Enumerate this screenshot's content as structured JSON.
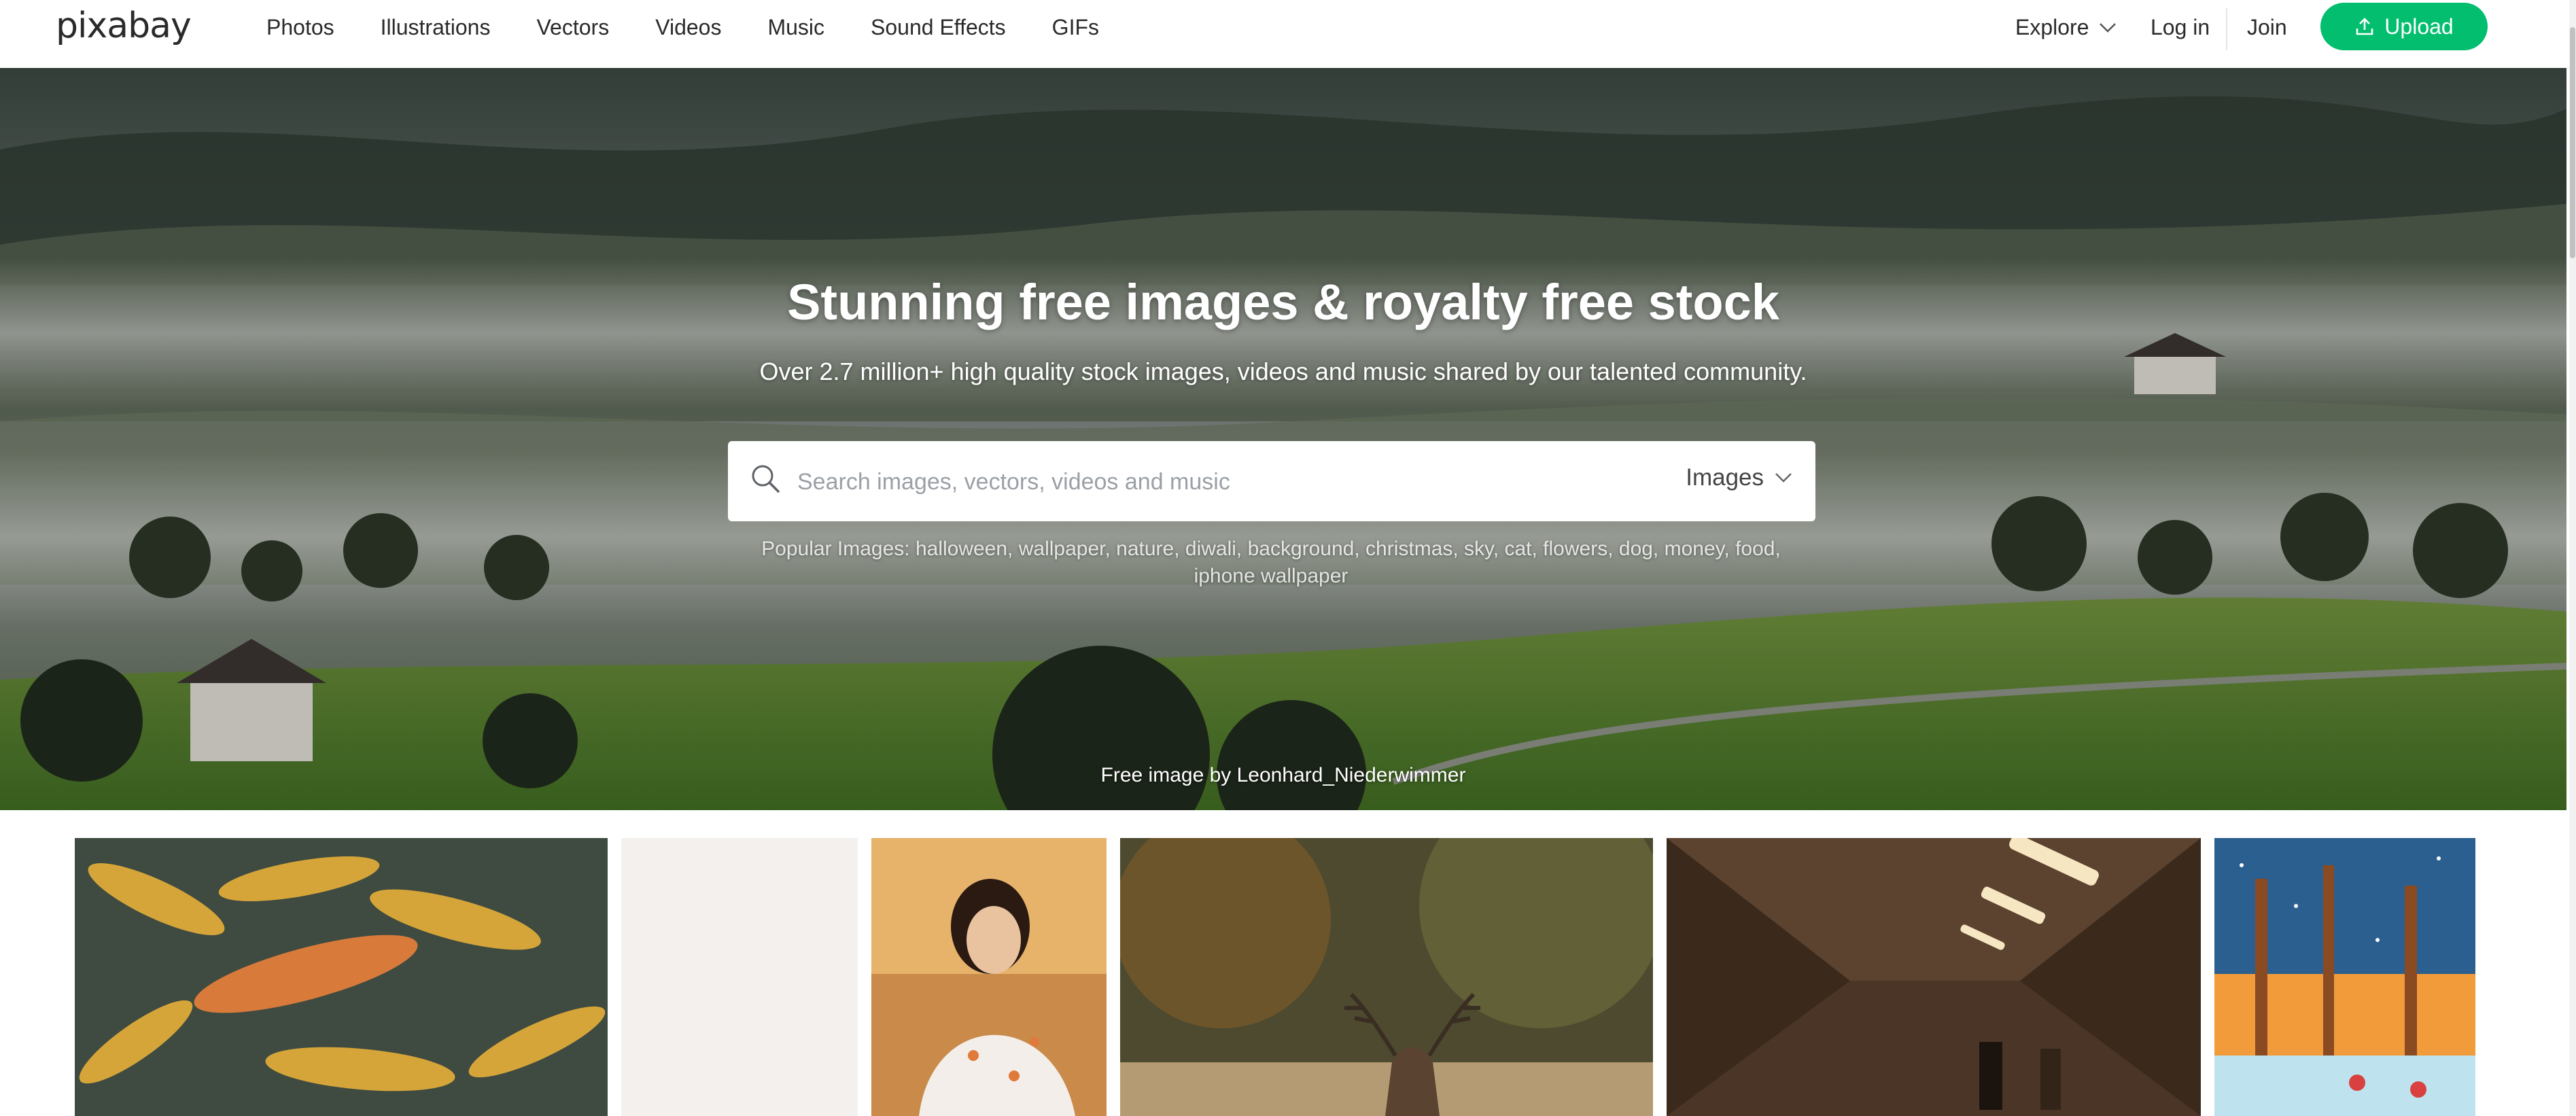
{
  "brand": {
    "logo_text": "pixabay",
    "accent": "#02be6e"
  },
  "nav": {
    "links": [
      "Photos",
      "Illustrations",
      "Vectors",
      "Videos",
      "Music",
      "Sound Effects",
      "GIFs"
    ],
    "explore": "Explore",
    "login": "Log in",
    "join": "Join",
    "upload": "Upload"
  },
  "hero": {
    "title": "Stunning free images & royalty free stock",
    "subtitle": "Over 2.7 million+ high quality stock images, videos and music shared by our talented community.",
    "search": {
      "placeholder": "Search images, vectors, videos and music",
      "type": "Images"
    },
    "popular_label": "Popular Images:",
    "popular_terms": "halloween, wallpaper, nature, diwali, background, christmas, sky, cat, flowers, dog, money, food, iphone wallpaper",
    "credit": "Free image by Leonhard_Niederwimmer"
  },
  "icons": {
    "search": "search-icon",
    "chevron": "chevron-down-icon",
    "upload": "upload-icon"
  }
}
